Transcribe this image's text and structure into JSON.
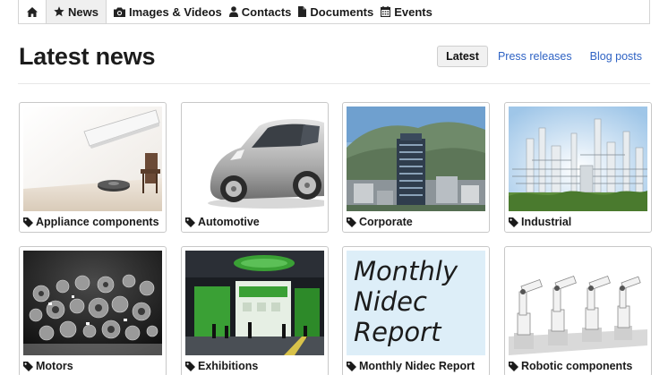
{
  "nav": {
    "items": [
      {
        "id": "home",
        "label": "",
        "icon": "home-icon"
      },
      {
        "id": "news",
        "label": "News",
        "icon": "star-icon",
        "active": true
      },
      {
        "id": "images",
        "label": "Images & Videos",
        "icon": "camera-icon"
      },
      {
        "id": "contacts",
        "label": "Contacts",
        "icon": "user-icon"
      },
      {
        "id": "documents",
        "label": "Documents",
        "icon": "document-icon"
      },
      {
        "id": "events",
        "label": "Events",
        "icon": "calendar-icon"
      }
    ]
  },
  "page": {
    "title": "Latest news"
  },
  "tabs": [
    {
      "label": "Latest",
      "active": true
    },
    {
      "label": "Press releases",
      "active": false
    },
    {
      "label": "Blog posts",
      "active": false
    }
  ],
  "categories": [
    {
      "label": "Appliance components"
    },
    {
      "label": "Automotive"
    },
    {
      "label": "Corporate"
    },
    {
      "label": "Industrial"
    },
    {
      "label": "Motors"
    },
    {
      "label": "Exhibitions"
    },
    {
      "label": "Monthly Nidec Report",
      "thumb_text": [
        "Monthly",
        "Nidec",
        "Report"
      ]
    },
    {
      "label": "Robotic components"
    }
  ],
  "colors": {
    "link": "#2f63c4",
    "active_tab_bg": "#f1f1f1",
    "border": "#c8c8c8",
    "exhibit_green": "#3aa035"
  }
}
